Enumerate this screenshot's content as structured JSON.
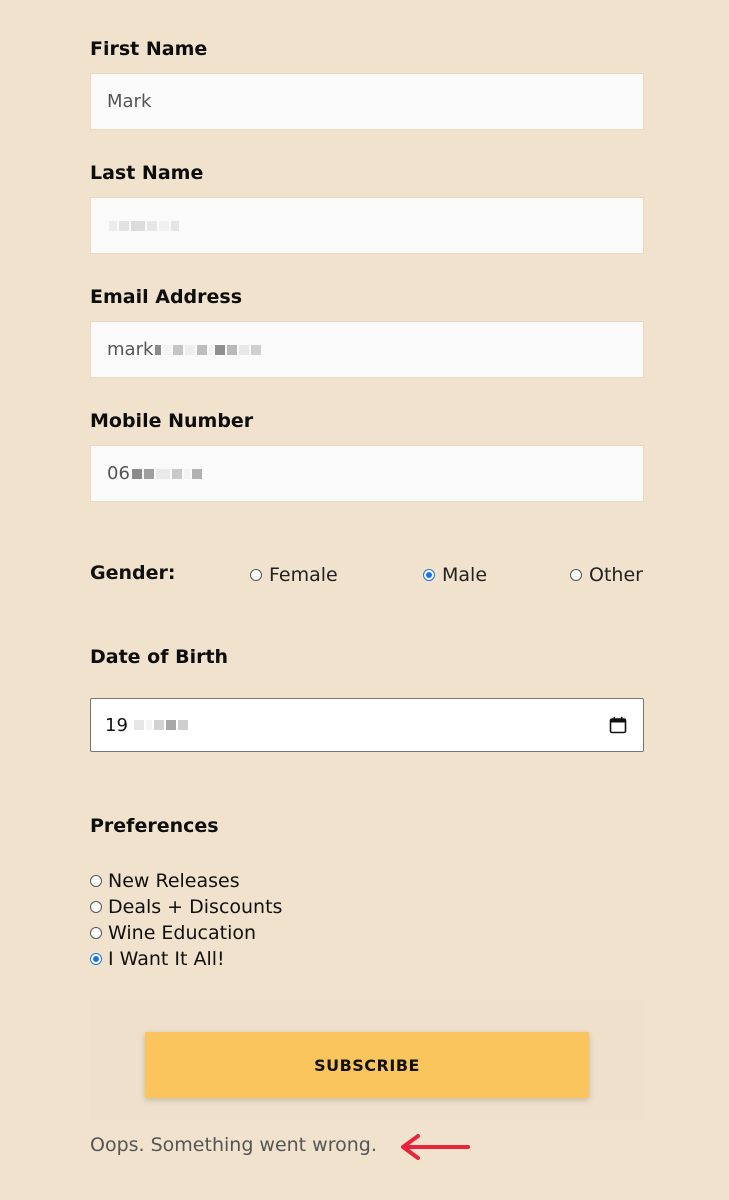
{
  "form": {
    "first_name": {
      "label": "First Name",
      "value": "Mark"
    },
    "last_name": {
      "label": "Last Name",
      "value": ""
    },
    "email": {
      "label": "Email Address",
      "value": "mark"
    },
    "mobile": {
      "label": "Mobile Number",
      "value": "06"
    },
    "gender": {
      "label": "Gender:",
      "options": [
        "Female",
        "Male",
        "Other"
      ],
      "selected": "Male"
    },
    "dob": {
      "label": "Date of Birth",
      "value": "19"
    },
    "preferences": {
      "label": "Preferences",
      "options": [
        "New Releases",
        "Deals + Discounts",
        "Wine Education",
        "I Want It All!"
      ],
      "selected": "I Want It All!"
    },
    "subscribe_label": "SUBSCRIBE",
    "error_message": "Oops. Something went wrong."
  },
  "colors": {
    "background": "#f0e2cc",
    "button": "#f9c55c",
    "arrow": "#e8243c",
    "radio_accent": "#1a73e8"
  },
  "icons": {
    "date": "calendar-icon",
    "annotation": "arrow-left-icon"
  }
}
